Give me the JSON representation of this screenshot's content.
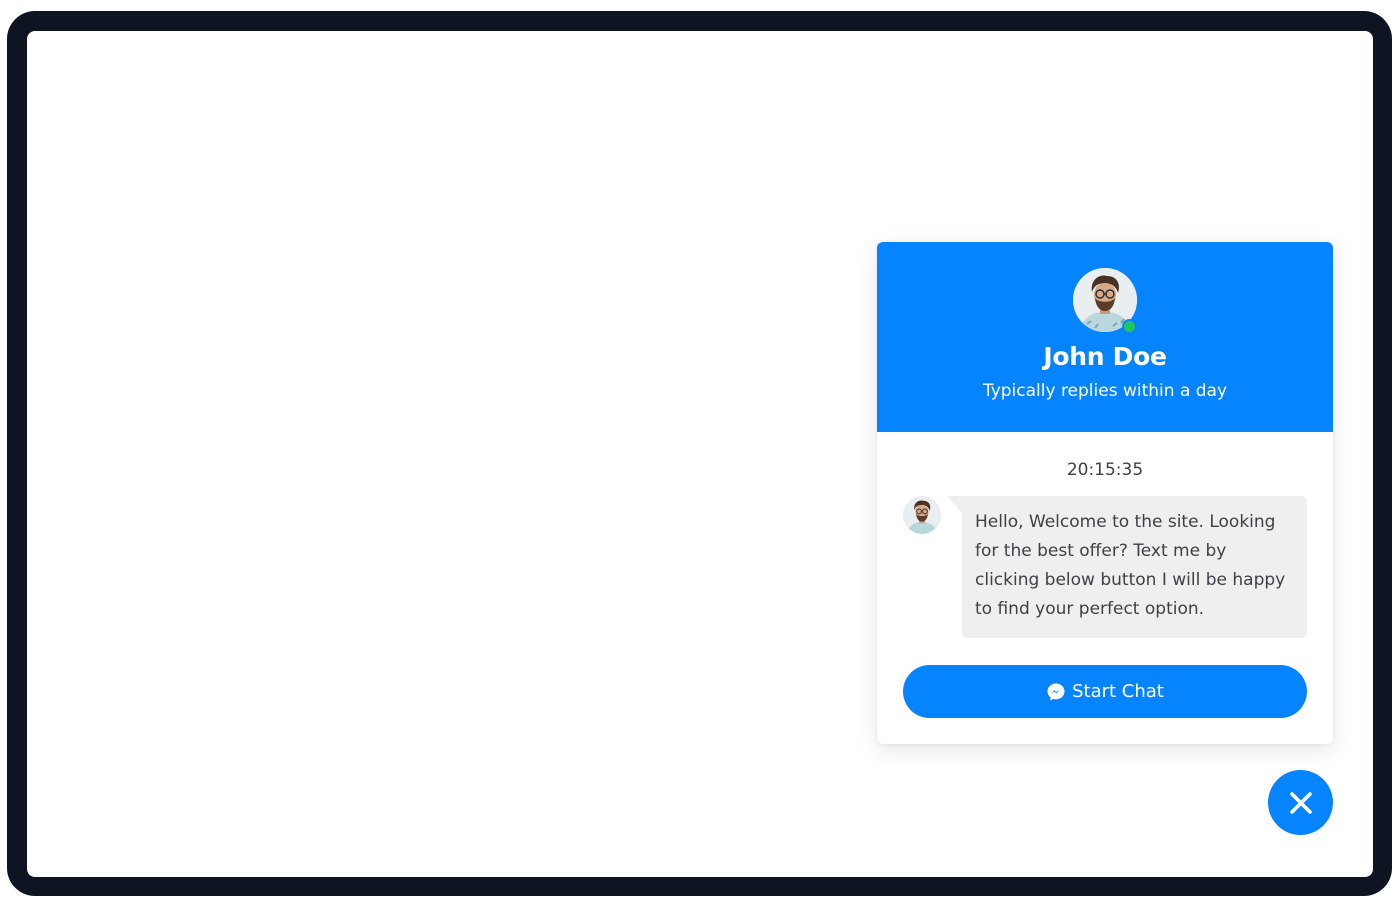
{
  "widget": {
    "agent_name": "John Doe",
    "agent_status": "Typically replies within a day",
    "timestamp": "20:15:35",
    "message": "Hello, Welcome to the site. Looking for the best offer? Text me by clicking below button I will be happy to find your perfect option.",
    "start_button_label": "Start Chat",
    "start_button_icon": "messenger-icon",
    "online_indicator": "online"
  },
  "close_button": {
    "icon": "close-icon"
  },
  "colors": {
    "accent": "#0684fe",
    "online": "#22c55e",
    "frame": "#0e1421",
    "bubble": "#efefef",
    "text": "#3f3f46"
  }
}
